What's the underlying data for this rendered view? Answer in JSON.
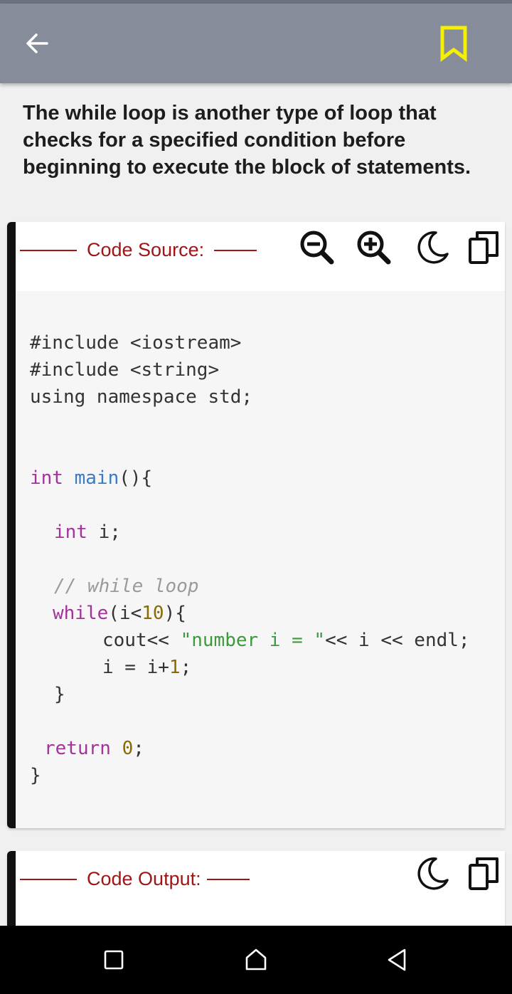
{
  "appbar": {
    "back_icon": "arrow-left-icon",
    "bookmark_icon": "bookmark-outline-icon",
    "bookmark_color": "#f5f000"
  },
  "intro_text": "The while loop is another type of loop that checks for a specified condition before beginning to execute the block of statements.",
  "source_card": {
    "label": "Code Source:",
    "tools": [
      "zoom-out-icon",
      "zoom-in-icon",
      "dark-mode-moon-icon",
      "copy-icon"
    ],
    "code": {
      "include1": "#include <iostream>",
      "include2": "#include <string>",
      "using": "using namespace std;",
      "main_kw": "int",
      "main_fn": "main",
      "main_rest": "(){",
      "decl_kw": "int",
      "decl_rest": " i;",
      "comment": "// while loop",
      "while_kw": "while",
      "while_a": "(i<",
      "while_num": "10",
      "while_b": "){",
      "cout_a": "cout<< ",
      "cout_str": "\"number i = \"",
      "cout_b": "<< i << endl;",
      "inc_a": "i = i+",
      "inc_num": "1",
      "inc_b": ";",
      "close_inner": "}",
      "ret_kw": "return",
      "ret_sp": " ",
      "ret_num": "0",
      "ret_semi": ";",
      "close_outer": "}"
    }
  },
  "output_card": {
    "label": "Code Output:",
    "tools": [
      "dark-mode-moon-icon",
      "copy-icon"
    ]
  },
  "navbar": {
    "buttons": [
      "recent-apps-icon",
      "home-icon",
      "back-triangle-icon"
    ]
  },
  "colors": {
    "appbar": "#878c9b",
    "accent_red": "#a01515",
    "keyword": "#a3339b",
    "function": "#3a7bc8",
    "number": "#8a6b00",
    "string": "#3c9a3c",
    "comment": "#9a9a9a"
  }
}
